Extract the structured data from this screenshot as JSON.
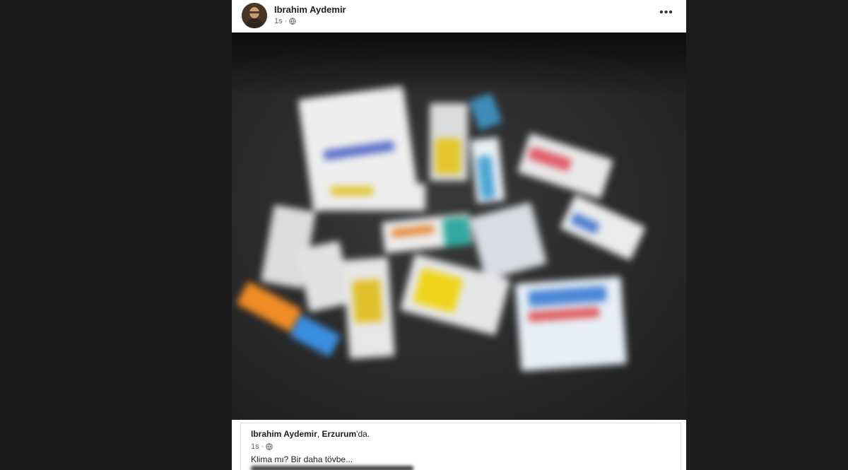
{
  "post": {
    "author": "Ibrahim Aydemir",
    "time": "1s",
    "separator": "·",
    "more_label": "•••"
  },
  "photo": {
    "icon": "blurred-medicines-photo"
  },
  "shared_post": {
    "author": "Ibrahim Aydemir",
    "location_prefix": ", ",
    "location": "Erzurum",
    "location_suffix": "'da.",
    "time": "1s",
    "separator": "·",
    "text": "Klima mı? Bir daha tövbe..."
  },
  "colors": {
    "page_background": "#1b1b1b",
    "card_background": "#ffffff",
    "secondary_text": "#65676b",
    "primary_text": "#1c1e21"
  }
}
